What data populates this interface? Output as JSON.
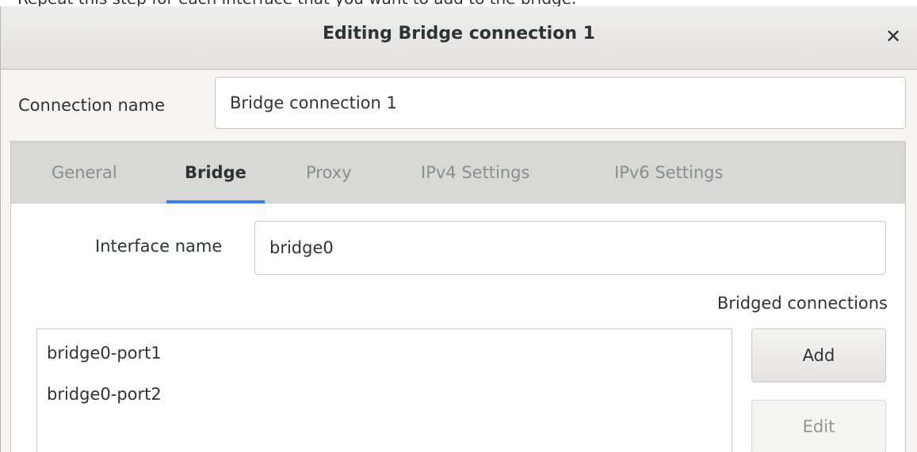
{
  "window": {
    "title": "Editing Bridge connection 1",
    "close_glyph": "✕",
    "top_strip_text": "Repeat this step for each interface that you want to add to the bridge."
  },
  "connection": {
    "label": "Connection name",
    "value": "Bridge connection 1"
  },
  "tabs": [
    {
      "label": "General",
      "active": false
    },
    {
      "label": "Bridge",
      "active": true
    },
    {
      "label": "Proxy",
      "active": false
    },
    {
      "label": "IPv4 Settings",
      "active": false
    },
    {
      "label": "IPv6 Settings",
      "active": false
    }
  ],
  "bridge": {
    "interface_label": "Interface name",
    "interface_value": "bridge0",
    "bridged_connections_label": "Bridged connections",
    "connections": [
      "bridge0-port1",
      "bridge0-port2"
    ],
    "add_label": "Add",
    "edit_label": "Edit"
  },
  "colors": {
    "accent": "#3584e4",
    "inactive_tab_text": "#8b8e8f",
    "tabbar_bg": "#d8d8d7"
  }
}
